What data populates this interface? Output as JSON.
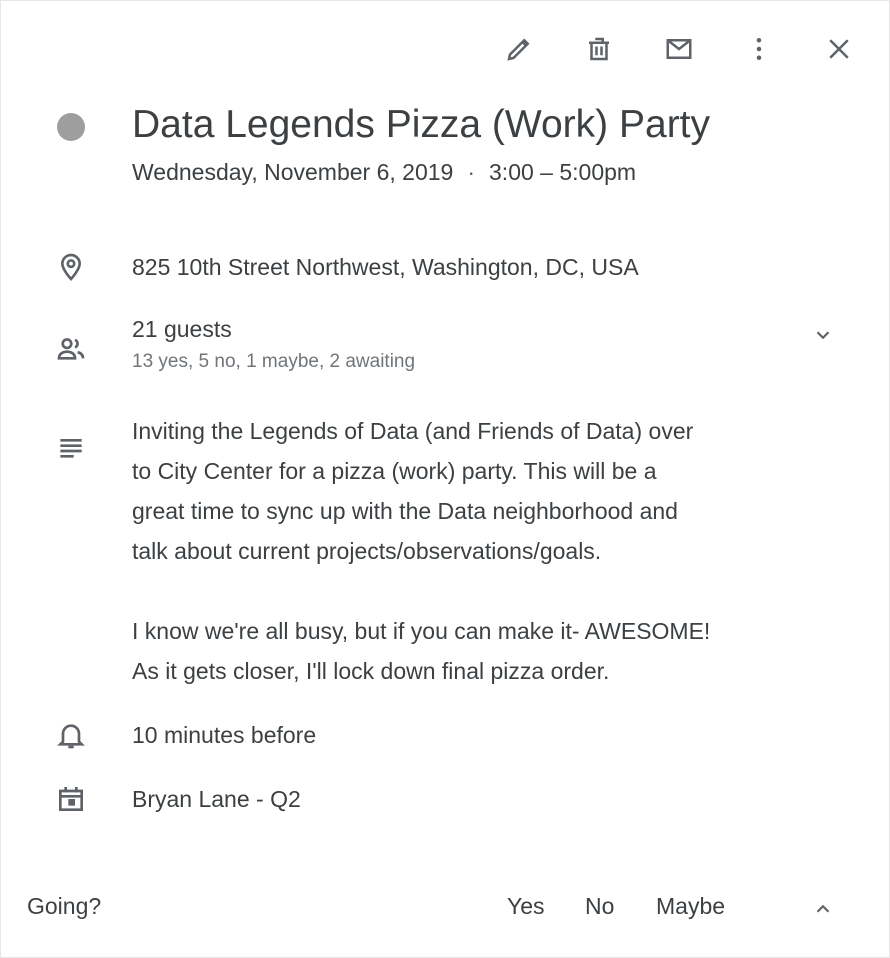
{
  "toolbar": {
    "icons": [
      "pencil-icon",
      "trash-icon",
      "mail-icon",
      "more-vert-icon",
      "close-icon"
    ]
  },
  "event": {
    "title": "Data Legends Pizza (Work) Party",
    "date": "Wednesday, November 6, 2019",
    "separator": "·",
    "time": "3:00 – 5:00pm",
    "color": "#9e9e9e"
  },
  "location": {
    "address": "825 10th Street Northwest, Washington, DC, USA"
  },
  "guests": {
    "count_label": "21 guests",
    "summary": "13 yes, 5 no, 1 maybe, 2 awaiting"
  },
  "description": {
    "paragraph1": [
      "Inviting the Legends of Data (and Friends of Data) over",
      "to City Center for a pizza (work) party. This will be a",
      "great time to sync up with the Data neighborhood and",
      "talk about current projects/observations/goals."
    ],
    "paragraph2": [
      "I know we're all busy, but if you can make it- AWESOME!",
      "As it gets closer, I'll lock down final pizza order."
    ]
  },
  "reminder": {
    "label": "10 minutes before"
  },
  "calendar": {
    "name": "Bryan Lane - Q2"
  },
  "footer": {
    "going_label": "Going?",
    "yes_label": "Yes",
    "no_label": "No",
    "maybe_label": "Maybe"
  }
}
